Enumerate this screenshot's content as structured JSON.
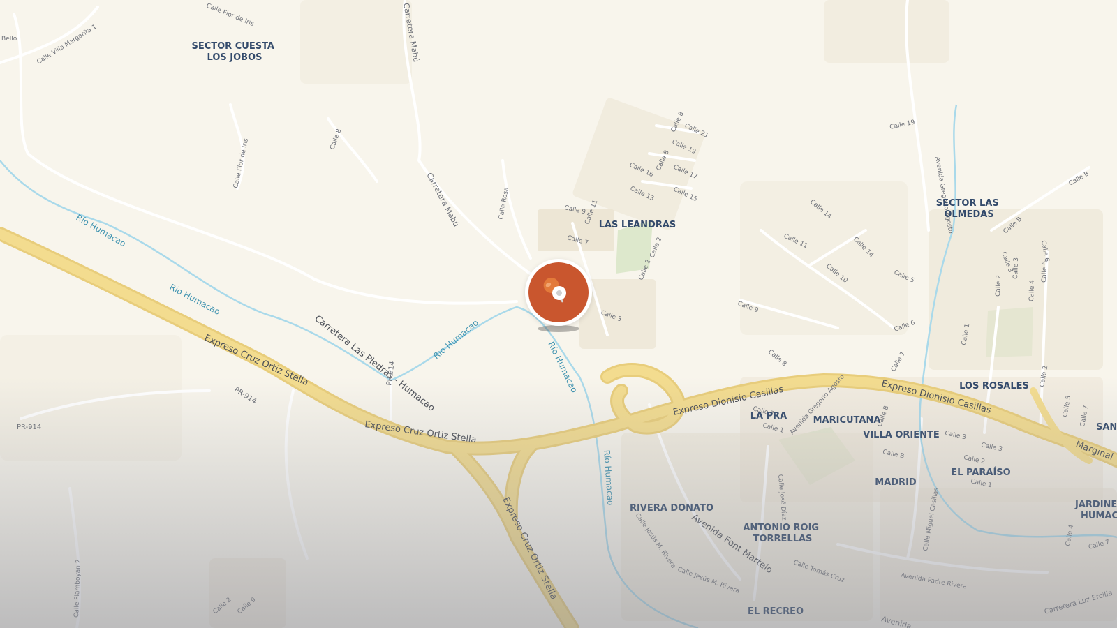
{
  "map": {
    "place_labels": [
      {
        "id": "sector-cuesta-los-jobos",
        "lines": [
          "SECTOR CUESTA",
          "LOS JOBOS"
        ]
      },
      {
        "id": "las-leandras",
        "lines": [
          "LAS LEANDRAS"
        ]
      },
      {
        "id": "sector-las-olmedas",
        "lines": [
          "SECTOR LAS",
          "OLMEDAS"
        ]
      },
      {
        "id": "los-rosales",
        "lines": [
          "LOS ROSALES"
        ]
      },
      {
        "id": "la-pra",
        "lines": [
          "LA PRA"
        ]
      },
      {
        "id": "maricutana",
        "lines": [
          "MARICUTANA"
        ]
      },
      {
        "id": "villa-oriente",
        "lines": [
          "VILLA ORIENTE"
        ]
      },
      {
        "id": "el-paraiso",
        "lines": [
          "EL PARAÍSO"
        ]
      },
      {
        "id": "madrid",
        "lines": [
          "MADRID"
        ]
      },
      {
        "id": "rivera-donato",
        "lines": [
          "RIVERA DONATO"
        ]
      },
      {
        "id": "antonio-roig-torrellas",
        "lines": [
          "ANTONIO ROIG",
          "TORRELLAS"
        ]
      },
      {
        "id": "el-recreo",
        "lines": [
          "EL RECREO"
        ]
      },
      {
        "id": "jardines-humacao",
        "lines": [
          "JARDINES",
          "HUMACA"
        ]
      },
      {
        "id": "san",
        "lines": [
          "SAN"
        ]
      }
    ],
    "road_labels": {
      "expreso_cruz_ortiz_stella": "Expreso Cruz Ortiz Stella",
      "expreso_dionisio_casillas": "Expreso Dionisio Casillas",
      "carretera_las_piedras": "Carretera Las Piedras - Humacao",
      "carretera_mabu": "Carretera Mabú",
      "avenida_font_martelo": "Avenida Font Martelo",
      "marginal": "Marginal",
      "pr_914": "PR-914",
      "avenida_gregorio_agosto": "Avenida Gregorio Agosto",
      "avenida_padre_rivera": "Avenida Padre Rivera",
      "carretera_luz_ercilia": "Carretera Luz Ercilia",
      "avenida": "Avenida"
    },
    "river_label": "Río Humacao",
    "street_labels": {
      "calle_flor_de_iris": "Calle Flor de Iris",
      "calle_villa_margarita": "Calle Villa Margarita 1",
      "calle_8": "Calle 8",
      "calle_rosa": "Calle Rosa",
      "calle_9": "Calle 9",
      "calle_11": "Calle 11",
      "calle_7": "Calle 7",
      "calle_2": "Calle 2",
      "calle_3": "Calle 3",
      "calle_21": "Calle 21",
      "calle_19": "Calle 19",
      "calle_17": "Calle 17",
      "calle_15": "Calle 15",
      "calle_13": "Calle 13",
      "calle_16": "Calle 16",
      "calle_14": "Calle 14",
      "calle_10": "Calle 10",
      "calle_5": "Calle 5",
      "calle_6": "Calle 6",
      "calle_b": "Calle B",
      "calle_1": "Calle 1",
      "calle_4": "Calle 4",
      "calle_jose_diaz": "Calle José Díaz",
      "calle_jesus_m_rivera": "Calle Jesús M. Rivera",
      "calle_tomas_cruz": "Calle Tomás Cruz",
      "calle_miguel_casillas": "Calle Miguel Casillas",
      "calle_flamboyan": "Calle Flamboyán 2",
      "bello": "Bello"
    }
  },
  "colors": {
    "background": "#f8f5ec",
    "highway": "#f3dc8f",
    "highway_casing": "#e8cd7b",
    "road": "#ffffff",
    "building": "#ece5d5",
    "park": "#d8e8c8",
    "river": "#a9d9ea",
    "pin": "#c9562e"
  },
  "marker": {
    "icon": "map-pin-icon"
  }
}
